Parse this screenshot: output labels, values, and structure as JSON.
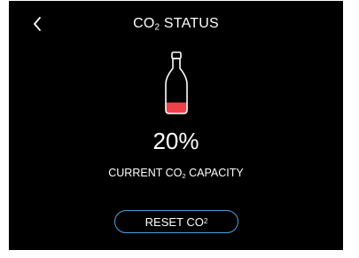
{
  "header": {
    "title_main": "CO",
    "title_sub": "2",
    "title_rest": " STATUS",
    "back_icon": "chevron-left-icon"
  },
  "status": {
    "percent": "20%",
    "level": 0.2,
    "caption_main": "CURRENT CO",
    "caption_sub": "2",
    "caption_rest": " CAPACITY",
    "fill_color": "#f0414a"
  },
  "actions": {
    "reset_main": "RESET CO",
    "reset_sub": "2"
  },
  "colors": {
    "background": "#000000",
    "text": "#ffffff",
    "button_border": "#4aa3df"
  }
}
